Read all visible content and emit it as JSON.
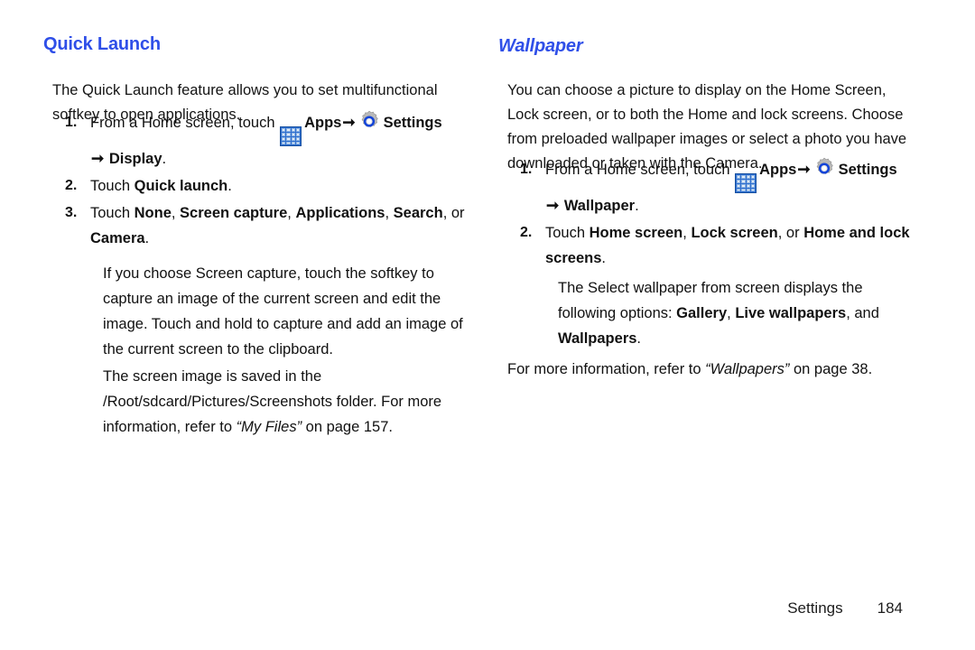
{
  "document": {
    "accent_color": "#2f4fe8",
    "text_color": "#141414"
  },
  "left_column": {
    "heading": "Quick Launch",
    "intro": "The Quick Launch feature allows you to set multifunctional softkey to open applications.",
    "steps": [
      {
        "number": "1.",
        "prefix": "From a Home screen, touch ",
        "apps_label": "Apps",
        "arrow": "➞",
        "settings_label": "Settings",
        "continuation_arrow": "➞",
        "continuation_bold": "Display",
        "continuation_suffix": "."
      },
      {
        "number": "2.",
        "prefix": "Touch ",
        "bold_1": "Quick launch",
        "suffix": "."
      },
      {
        "number": "3.",
        "prefix": "Touch ",
        "bold_1": "None",
        "sep_1": ", ",
        "bold_2": "Screen capture",
        "sep_2": ", ",
        "bold_3": "Applications",
        "sep_3": ", ",
        "bold_4": "Search",
        "sep_4": ", or ",
        "bold_5": "Camera",
        "suffix": "."
      }
    ],
    "note_1": "If you choose Screen capture, touch the softkey to capture an image of the current screen and edit the image. Touch and hold to capture and add an image of the current screen to the clipboard.",
    "note_2": {
      "prefix": "The screen image is saved in the /Root/sdcard/Pictures/Screenshots folder. For more information, refer to ",
      "italic_ref": "“My Files”",
      "suffix": " on page 157."
    }
  },
  "right_column": {
    "heading": "Wallpaper",
    "intro": "You can choose a picture to display on the Home Screen, Lock screen, or to both the Home and lock screens. Choose from preloaded wallpaper images or select a photo you have downloaded or taken with the Camera.",
    "steps": [
      {
        "number": "1.",
        "prefix": "From a Home screen, touch ",
        "apps_label": "Apps",
        "arrow": "➞",
        "settings_label": "Settings",
        "continuation_arrow": "➞",
        "continuation_bold": "Wallpaper",
        "continuation_suffix": "."
      },
      {
        "number": "2.",
        "prefix": "Touch ",
        "bold_1": "Home screen",
        "sep_1": ", ",
        "bold_2": "Lock screen",
        "sep_2": ", or ",
        "bold_3": "Home and lock screens",
        "suffix": "."
      }
    ],
    "note_1": {
      "prefix": "The Select wallpaper from screen displays the following options: ",
      "bold_1": "Gallery",
      "sep_1": ", ",
      "bold_2": "Live wallpapers",
      "sep_2": ", and ",
      "bold_3": "Wallpapers",
      "suffix": "."
    },
    "note_2": {
      "prefix": "For more information, refer to ",
      "italic_ref": "“Wallpapers”",
      "suffix": " on page 38."
    }
  },
  "footer": {
    "label": "Settings",
    "page_number": "184"
  },
  "icons": {
    "apps": "apps-grid-icon",
    "settings": "settings-gear-icon"
  }
}
